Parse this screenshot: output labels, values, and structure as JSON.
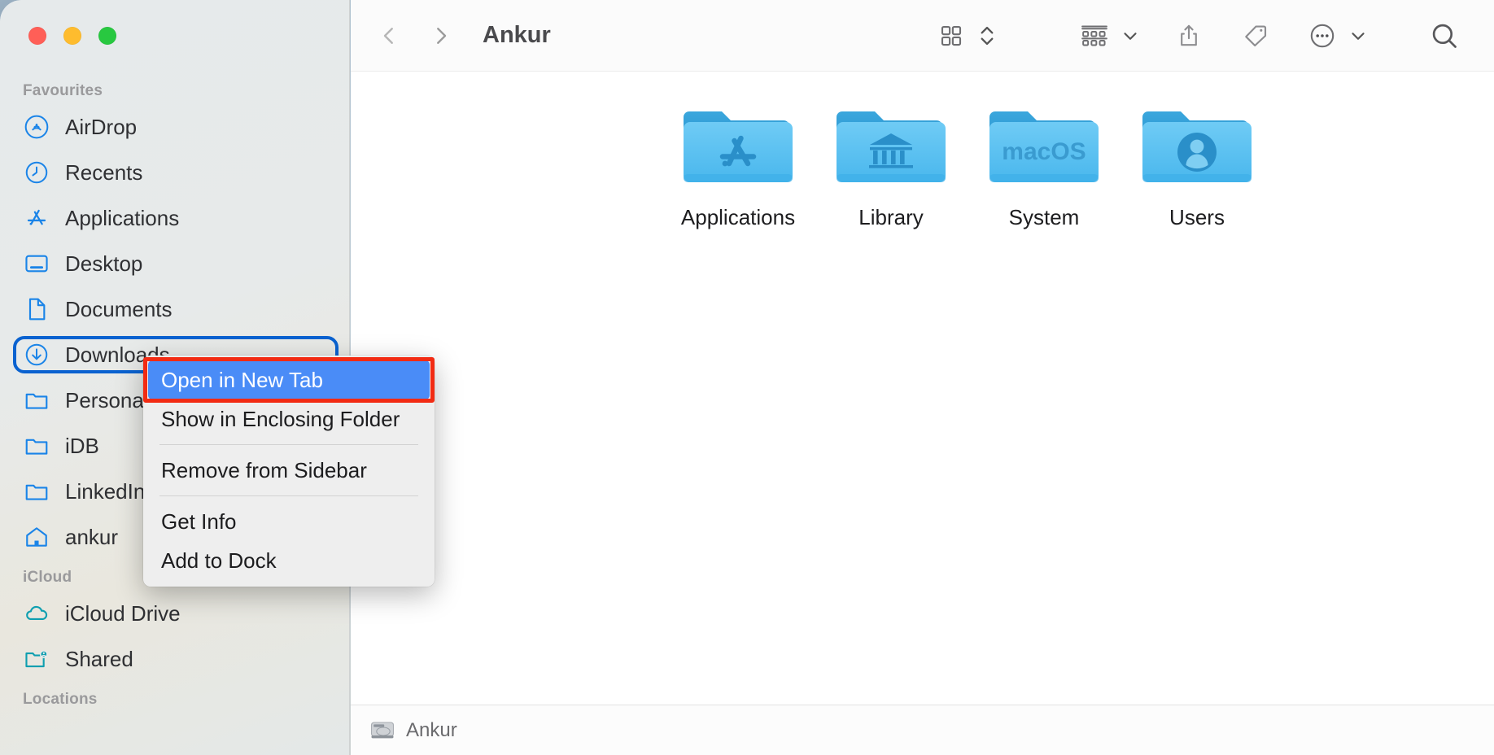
{
  "window": {
    "title": "Ankur",
    "traffic_lights": [
      "close-button",
      "minimize-button",
      "zoom-button"
    ]
  },
  "toolbar": {
    "back_label": "back",
    "forward_label": "forward",
    "icons": [
      "grid-view-icon",
      "sort-stepper-icon",
      "group-by-icon",
      "chevron-down-icon",
      "share-icon",
      "tag-icon",
      "more-ellipsis-icon",
      "chevron-down-icon",
      "search-icon"
    ]
  },
  "sidebar": {
    "sections": [
      {
        "title": "Favourites",
        "items": [
          {
            "label": "AirDrop",
            "icon": "airdrop-icon",
            "color": "#1a84e8"
          },
          {
            "label": "Recents",
            "icon": "clock-icon",
            "color": "#1a84e8"
          },
          {
            "label": "Applications",
            "icon": "app-store-icon",
            "color": "#1a84e8"
          },
          {
            "label": "Desktop",
            "icon": "desktop-icon",
            "color": "#1a84e8"
          },
          {
            "label": "Documents",
            "icon": "document-icon",
            "color": "#1a84e8"
          },
          {
            "label": "Downloads",
            "icon": "downloads-icon",
            "color": "#1a84e8",
            "focused": true
          },
          {
            "label": "Personal",
            "icon": "folder-icon",
            "color": "#1a84e8"
          },
          {
            "label": "iDB",
            "icon": "folder-icon",
            "color": "#1a84e8"
          },
          {
            "label": "LinkedIn",
            "icon": "folder-icon",
            "color": "#1a84e8"
          },
          {
            "label": "ankur",
            "icon": "home-icon",
            "color": "#1a84e8"
          }
        ]
      },
      {
        "title": "iCloud",
        "items": [
          {
            "label": "iCloud Drive",
            "icon": "cloud-icon",
            "color": "#0f9fb0"
          },
          {
            "label": "Shared",
            "icon": "shared-folder-icon",
            "color": "#0f9fb0"
          }
        ]
      },
      {
        "title": "Locations",
        "items": []
      }
    ]
  },
  "main": {
    "files": [
      {
        "name": "Applications",
        "icon": "folder-applications-icon",
        "glyph": "appstore"
      },
      {
        "name": "Library",
        "icon": "folder-library-icon",
        "glyph": "bank"
      },
      {
        "name": "System",
        "icon": "folder-system-icon",
        "glyph": "macOS"
      },
      {
        "name": "Users",
        "icon": "folder-users-icon",
        "glyph": "person"
      }
    ]
  },
  "pathbar": {
    "icon": "hard-drive-icon",
    "label": "Ankur"
  },
  "context_menu": {
    "items": [
      {
        "label": "Open in New Tab",
        "selected": true,
        "highlighted": true
      },
      {
        "label": "Show in Enclosing Folder",
        "selected": false,
        "highlighted": false
      },
      {
        "separator_after": true
      },
      {
        "label": "Remove from Sidebar",
        "selected": false,
        "highlighted": false
      },
      {
        "separator_after": true
      },
      {
        "label": "Get Info",
        "selected": false,
        "highlighted": false
      },
      {
        "label": "Add to Dock",
        "selected": false,
        "highlighted": false
      }
    ]
  },
  "colors": {
    "selection_blue": "#4a8cf7",
    "annotation_red": "#f22b13",
    "focus_ring_blue": "#0a62d0",
    "folder_blue": "#56bdf0",
    "sidebar_icon_blue": "#1a84e8",
    "icloud_teal": "#0f9fb0"
  }
}
